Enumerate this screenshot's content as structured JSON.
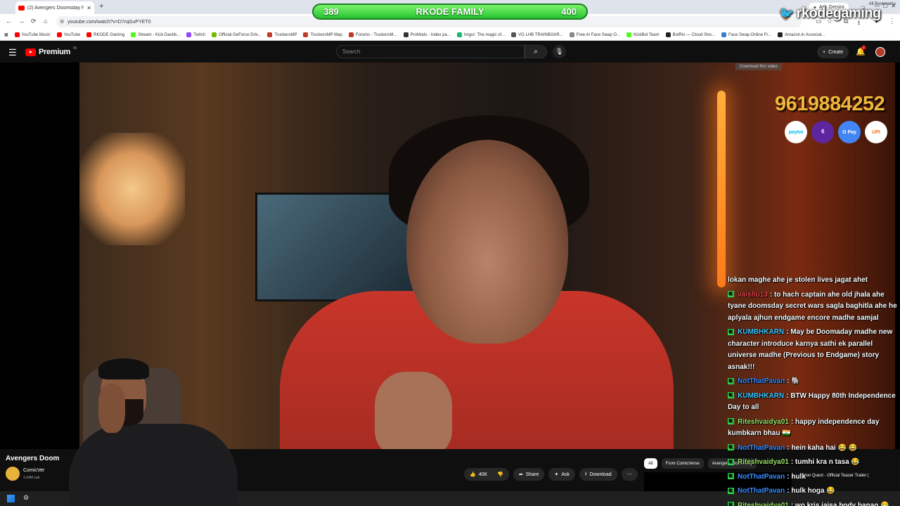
{
  "browser": {
    "tab_title": "(2) Avengers Doomsday Ne",
    "url": "youtube.com/watch?v=D7rqGuPYET0",
    "bookmarks": [
      {
        "label": "YouTube Music",
        "color": "#ff0000"
      },
      {
        "label": "YouTube",
        "color": "#ff0000"
      },
      {
        "label": "RKODE Gaming",
        "color": "#ff0000"
      },
      {
        "label": "Stream - Kick Dashb...",
        "color": "#53fc18"
      },
      {
        "label": "Twitch",
        "color": "#9146ff"
      },
      {
        "label": "Official GeForce Driv...",
        "color": "#76b900"
      },
      {
        "label": "TruckersMP",
        "color": "#c0392b"
      },
      {
        "label": "TruckersMP Map",
        "color": "#c0392b"
      },
      {
        "label": "Forums - TruckersM...",
        "color": "#c0392b"
      },
      {
        "label": "ProMods - Index pa...",
        "color": "#333333"
      },
      {
        "label": "Imgur: The magic of...",
        "color": "#1bb76e"
      },
      {
        "label": "VG LHB TRAINBOAR...",
        "color": "#555555"
      },
      {
        "label": "Free AI Face Swap O...",
        "color": "#888888"
      },
      {
        "label": "KickBot Team",
        "color": "#53fc18"
      },
      {
        "label": "BotRix — Cloud Stre...",
        "color": "#222222"
      },
      {
        "label": "Face Swap Online Fr...",
        "color": "#3a7bd5"
      },
      {
        "label": "Amazon.in Associat...",
        "color": "#222222"
      }
    ],
    "all_bookmarks": "All Bookmarks",
    "ask_gemini": "Ask Gemini"
  },
  "overlay": {
    "left_count": "389",
    "banner_title": "RKODE FAMILY",
    "right_count": "400",
    "twitter_handle": "rkodegaming",
    "download_video": "Download this video",
    "phone_number": "9619884252",
    "payments": [
      {
        "label": "paytm",
        "bg": "#ffffff",
        "fg": "#00baf2"
      },
      {
        "label": "पे",
        "bg": "#5f259f",
        "fg": "#ffffff"
      },
      {
        "label": "G Pay",
        "bg": "#4285f4",
        "fg": "#ffffff"
      },
      {
        "label": "UPI",
        "bg": "#ffffff",
        "fg": "#f37021"
      }
    ]
  },
  "youtube": {
    "logo_text": "Premium",
    "logo_cc": "IN",
    "search_placeholder": "Search",
    "create_label": "Create",
    "notif_count": "2"
  },
  "chat": [
    {
      "user": "",
      "user_color": "#ffffff",
      "text": "lokan maghe ahe je stolen lives jagat ahet",
      "badge": false
    },
    {
      "user": "vaishu13",
      "user_color": "#e0484d",
      "text": ": to hach captain ahe old jhala ahe tyane doomsday secret wars sagla baghitla ahe he aplyala ajhun endgame encore madhe samjal",
      "badge": true
    },
    {
      "user": "KUMBHKARN",
      "user_color": "#3ec7ff",
      "text": ": May be Doomaday madhe new character introduce karnya sathi ek parallel universe madhe (Previous to Endgame) story asnak!!!",
      "badge": true
    },
    {
      "user": "NotThatPavan",
      "user_color": "#3a8dff",
      "text": ": 🐘",
      "badge": true
    },
    {
      "user": "KUMBHKARN",
      "user_color": "#3ec7ff",
      "text": ": BTW Happy 80th Independence Day to all",
      "badge": true
    },
    {
      "user": "Riteshvaidya01",
      "user_color": "#9be36a",
      "text": ": happy independence day kumbkarn bhau 🇮🇳",
      "badge": true
    },
    {
      "user": "NotThatPavan",
      "user_color": "#3a8dff",
      "text": ": hein kaha hai 😂 😂",
      "badge": true
    },
    {
      "user": "Riteshvaidya01",
      "user_color": "#9be36a",
      "text": ": tumhi kra n tasa 😂",
      "badge": true
    },
    {
      "user": "NotThatPavan",
      "user_color": "#3a8dff",
      "text": ": hulk",
      "badge": true
    },
    {
      "user": "NotThatPavan",
      "user_color": "#3a8dff",
      "text": ": hulk hoga 😂",
      "badge": true
    },
    {
      "user": "Riteshvaidya01",
      "user_color": "#9be36a",
      "text": ": wo kris jaisa body banao 😂",
      "badge": true
    }
  ],
  "video_info": {
    "title": "Avengers Doom",
    "channel": "ComicVer",
    "subscribers": "1.64M sub",
    "likes": "40K",
    "share": "Share",
    "ask": "Ask",
    "download": "Download"
  },
  "sidebar": {
    "chips": [
      "All",
      "From ComicVerse",
      "Avengers: Doomsday"
    ],
    "rec_title": "Vision Quest - Official Teaser Trailer |"
  }
}
